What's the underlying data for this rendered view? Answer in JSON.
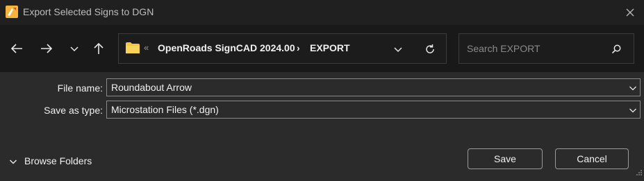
{
  "window": {
    "title": "Export Selected Signs to DGN"
  },
  "icons": {
    "app": "app-icon",
    "close": "close-icon",
    "back": "arrow-left-icon",
    "forward": "arrow-right-icon",
    "recent": "chevron-down-icon",
    "up": "arrow-up-icon",
    "folder": "folder-icon",
    "refresh": "refresh-icon",
    "search": "search-icon"
  },
  "address": {
    "overflow": "«",
    "crumbs": [
      "OpenRoads SignCAD 2024.00",
      "EXPORT"
    ],
    "separator": "›"
  },
  "search": {
    "placeholder": "Search EXPORT"
  },
  "form": {
    "file_name_label": "File name:",
    "file_name_value": "Roundabout Arrow",
    "save_type_label": "Save as type:",
    "save_type_value": "Microstation Files (*.dgn)"
  },
  "footer": {
    "browse_label": "Browse Folders",
    "save_label": "Save",
    "cancel_label": "Cancel"
  },
  "colors": {
    "titlebar": "#202020",
    "navbar": "#191919",
    "body": "#2b2b2b",
    "folder": "#f4c542",
    "text": "#f0f0f0"
  }
}
